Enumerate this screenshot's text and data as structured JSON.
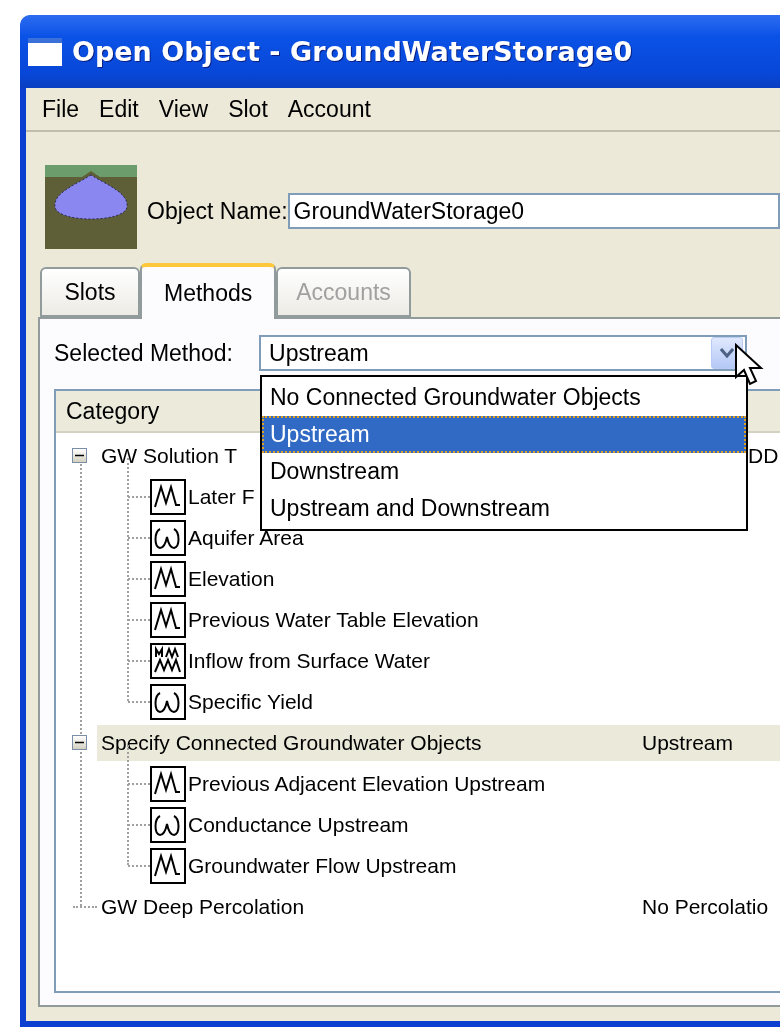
{
  "window": {
    "title": "Open Object - GroundWaterStorage0"
  },
  "menu": [
    "File",
    "Edit",
    "View",
    "Slot",
    "Account"
  ],
  "object_name": {
    "label": "Object Name:",
    "value": "GroundWaterStorage0"
  },
  "tabs": [
    {
      "label": "Slots",
      "selected": false,
      "disabled": false
    },
    {
      "label": "Methods",
      "selected": true,
      "disabled": false
    },
    {
      "label": "Accounts",
      "selected": false,
      "disabled": true
    }
  ],
  "method_select": {
    "label": "Selected Method:",
    "value": "Upstream",
    "open": true,
    "options": [
      {
        "label": "No Connected Groundwater Objects",
        "selected": false
      },
      {
        "label": "Upstream",
        "selected": true
      },
      {
        "label": "Downstream",
        "selected": false
      },
      {
        "label": "Upstream and Downstream",
        "selected": false
      }
    ]
  },
  "tree": {
    "columns": [
      "Category"
    ],
    "items": [
      {
        "label": "GW Solution T",
        "value": "DD",
        "selected": false,
        "expanded": true,
        "children": [
          {
            "label": "Later F",
            "kind": "series",
            "selected": false
          },
          {
            "label": "Aquifer Area",
            "kind": "scalar",
            "selected": false
          },
          {
            "label": "Elevation",
            "kind": "series",
            "selected": false
          },
          {
            "label": "Previous Water Table Elevation",
            "kind": "series",
            "selected": false
          },
          {
            "label": "Inflow from Surface Water",
            "kind": "agg",
            "selected": false
          },
          {
            "label": "Specific Yield",
            "kind": "scalar",
            "selected": false
          }
        ]
      },
      {
        "label": "Specify Connected Groundwater Objects",
        "value": "Upstream",
        "selected": true,
        "expanded": true,
        "children": [
          {
            "label": "Previous Adjacent Elevation Upstream",
            "kind": "series",
            "selected": false
          },
          {
            "label": "Conductance Upstream",
            "kind": "scalar",
            "selected": false
          },
          {
            "label": "Groundwater Flow Upstream",
            "kind": "series",
            "selected": false
          }
        ]
      },
      {
        "label": "GW Deep Percolation",
        "value": "No Percolatio",
        "selected": false
      }
    ]
  }
}
